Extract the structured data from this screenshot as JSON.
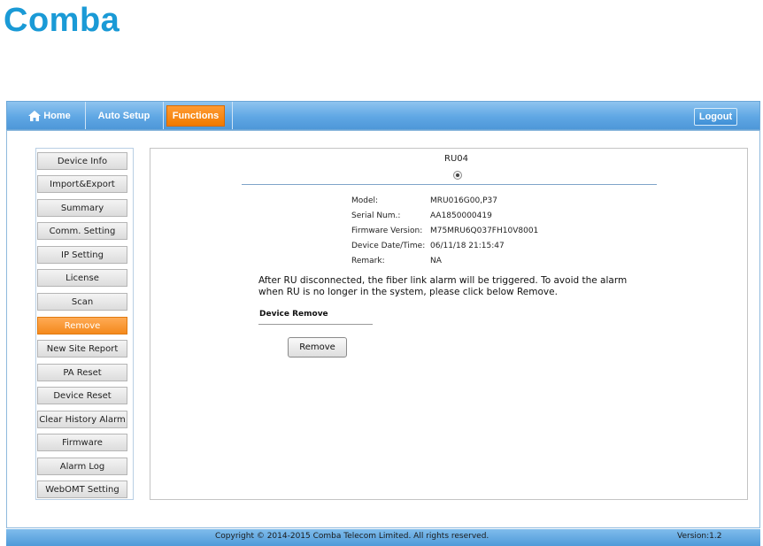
{
  "brand": {
    "logo_text": "Comba"
  },
  "nav": {
    "home": "Home",
    "auto_setup": "Auto Setup",
    "functions": "Functions",
    "logout": "Logout"
  },
  "sidebar": {
    "items": [
      {
        "label": "Device Info"
      },
      {
        "label": "Import&Export"
      },
      {
        "label": "Summary"
      },
      {
        "label": "Comm. Setting"
      },
      {
        "label": "IP Setting"
      },
      {
        "label": "License"
      },
      {
        "label": "Scan"
      },
      {
        "label": "Remove",
        "active": true
      },
      {
        "label": "New Site Report"
      },
      {
        "label": "PA Reset"
      },
      {
        "label": "Device Reset"
      },
      {
        "label": "Clear History Alarm"
      },
      {
        "label": "Firmware"
      },
      {
        "label": "Alarm Log"
      },
      {
        "label": "WebOMT Setting"
      }
    ]
  },
  "content": {
    "ru_label": "RU04",
    "info": [
      {
        "label": "Model:",
        "value": "MRU016G00,P37"
      },
      {
        "label": "Serial Num.:",
        "value": "AA1850000419"
      },
      {
        "label": "Firmware Version:",
        "value": "M75MRU6Q037FH10V8001"
      },
      {
        "label": "Device Date/Time:",
        "value": "06/11/18 21:15:47"
      },
      {
        "label": "Remark:",
        "value": "NA"
      }
    ],
    "note": "After RU disconnected, the fiber link alarm will be triggered. To avoid the alarm when RU is no longer in the system, please click below Remove.",
    "device_remove_title": "Device Remove",
    "remove_button": "Remove"
  },
  "footer": {
    "copyright": "Copyright © 2014-2015 Comba Telecom Limited. All rights reserved.",
    "version": "Version:1.2"
  },
  "colors": {
    "brand_blue": "#1a9ad6",
    "nav_blue": "#5fa7e4",
    "active_orange": "#f4891c"
  }
}
